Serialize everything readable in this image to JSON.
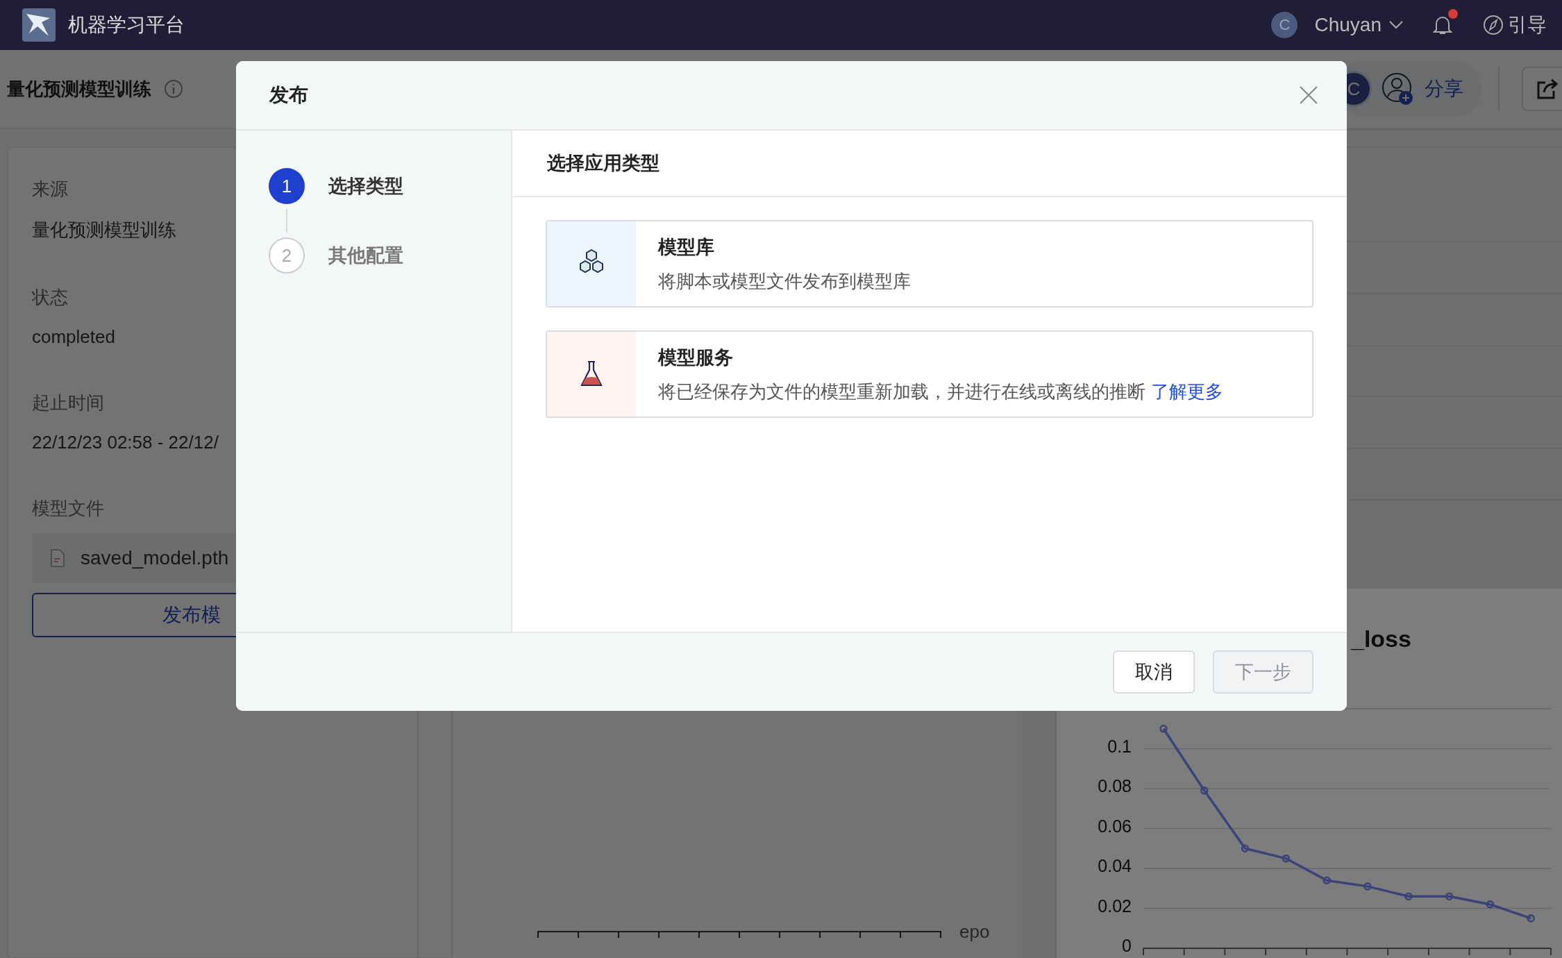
{
  "topbar": {
    "title": "机器学习平台",
    "user": {
      "avatar": "C",
      "name": "Chuyan"
    },
    "notifications": {
      "unread": true
    },
    "guide": "引导"
  },
  "page": {
    "title": "量化预测模型训练",
    "share": {
      "avatar": "C",
      "label": "分享"
    },
    "details": [
      {
        "kind": "text",
        "label": "来源",
        "value": "量化预测模型训练"
      },
      {
        "kind": "text",
        "label": "状态",
        "value": "completed"
      },
      {
        "kind": "text",
        "label": "起止时间",
        "value": "22/12/23 02:58 - 22/12/"
      },
      {
        "kind": "file",
        "label": "模型文件",
        "value": "saved_model.pth"
      }
    ],
    "publish_button": "发布模"
  },
  "epoch_chart": {
    "xlabel": "epo"
  },
  "loss_chart": {
    "chart_data": {
      "type": "line",
      "title": "_loss",
      "grid": true,
      "ylim": [
        0,
        0.12
      ],
      "yticks": [
        0,
        0.02,
        0.04,
        0.06,
        0.08,
        0.1
      ],
      "series": [
        {
          "color": "#3b4379",
          "marker": true,
          "values": [
            0.11,
            0.079,
            0.05,
            0.045,
            0.034,
            0.031,
            0.026,
            0.026,
            0.022,
            0.015
          ]
        }
      ]
    }
  },
  "dialog": {
    "title": "发布",
    "steps": [
      {
        "number": "1",
        "label": "选择类型",
        "selected": true
      },
      {
        "number": "2",
        "label": "其他配置",
        "selected": false
      }
    ],
    "section_title": "选择应用类型",
    "options": [
      {
        "kind": "library",
        "title": "模型库",
        "description": "将脚本或模型文件发布到模型库"
      },
      {
        "kind": "service",
        "title": "模型服务",
        "description": "将已经保存为文件的模型重新加载，并进行在线或离线的推断",
        "link": "了解更多"
      }
    ],
    "buttons": [
      {
        "label": "取消",
        "disabled": false
      },
      {
        "label": "下一步",
        "disabled": true
      }
    ]
  }
}
